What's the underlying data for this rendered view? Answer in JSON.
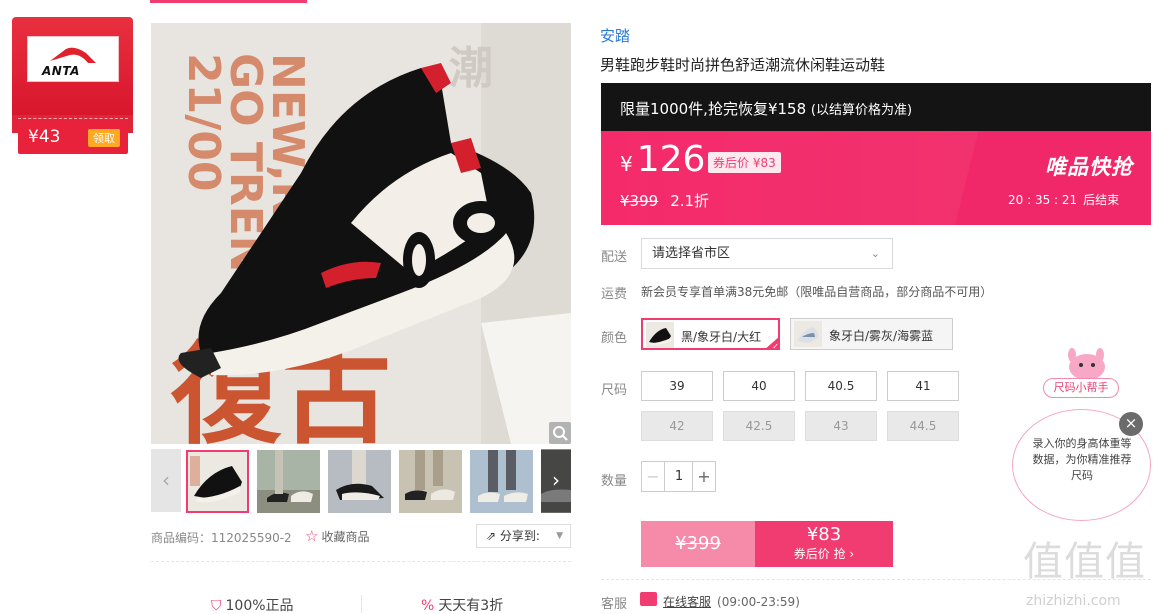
{
  "coupon": {
    "price": "¥43",
    "claim_label": "领取",
    "logo_text": "ANTA"
  },
  "product": {
    "brand": "安踏",
    "title": "男鞋跑步鞋时尚拼色舒适潮流休闲鞋运动鞋",
    "sku_label": "商品编码：",
    "sku_value": "112025590-2",
    "favorite_label": "收藏商品",
    "share_label": "分享到:"
  },
  "image_text": {
    "line1": "21/00",
    "line2": "GO TREN",
    "line3": "NEW,RETRO",
    "cn_big": "復古",
    "cn_small": "潮"
  },
  "promo": {
    "limit_text": "限量1000件,抢完恢复¥158",
    "limit_note": "(以结算价格为准)",
    "price_symbol": "¥",
    "price": "126",
    "after_coupon": "券后价 ¥83",
    "original_price": "¥399",
    "discount": "2.1折",
    "flash_logo": "唯品快抢",
    "countdown": "20 : 35 : 21",
    "countdown_suffix": "后结束"
  },
  "shipping": {
    "label": "配送",
    "placeholder": "请选择省市区",
    "freight_label": "运费",
    "freight_text": "新会员专享首单满38元免邮（限唯品自营商品，部分商品不可用）"
  },
  "colors": {
    "label": "颜色",
    "options": [
      {
        "name": "黑/象牙白/大红",
        "selected": true
      },
      {
        "name": "象牙白/雾灰/海雾蓝",
        "selected": false
      }
    ]
  },
  "sizes": {
    "label": "尺码",
    "options": [
      {
        "value": "39",
        "available": true
      },
      {
        "value": "40",
        "available": true
      },
      {
        "value": "40.5",
        "available": true
      },
      {
        "value": "41",
        "available": true
      },
      {
        "value": "42",
        "available": false
      },
      {
        "value": "42.5",
        "available": false
      },
      {
        "value": "43",
        "available": false
      },
      {
        "value": "44.5",
        "available": false
      }
    ]
  },
  "quantity": {
    "label": "数量",
    "value": "1",
    "minus": "−",
    "plus": "+"
  },
  "buy": {
    "original": "¥399",
    "coupon_price": "¥83",
    "coupon_action": "券后价 抢 ›"
  },
  "service": {
    "label": "客服",
    "link": "在线客服",
    "hours": "(09:00-23:59)"
  },
  "guarantees": [
    "100%正品",
    "天天有3折"
  ],
  "size_helper": {
    "tag": "尺码小帮手",
    "text": "录入你的身高体重等数据，为你精准推荐尺码",
    "close": "×"
  },
  "watermark": {
    "text": "值值值",
    "url": "zhizhizhi.com"
  },
  "colors_theme": {
    "accent": "#f03c71",
    "link": "#2a7ad6",
    "promo_dark": "#141414"
  }
}
